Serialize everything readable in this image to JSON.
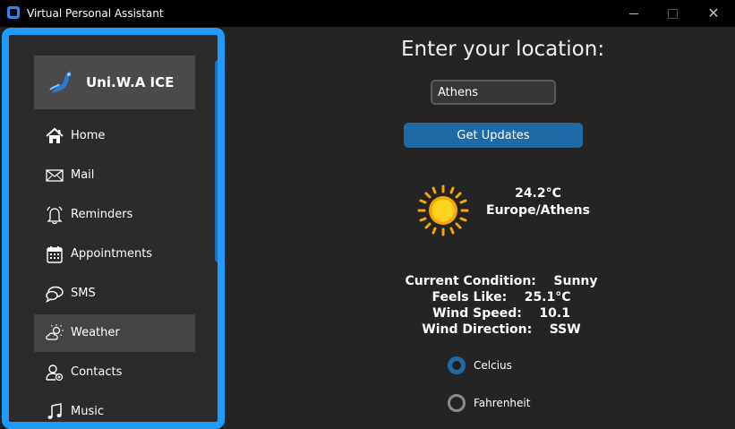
{
  "window": {
    "title": "Virtual Personal Assistant",
    "minimize": "",
    "maximize": "",
    "close": "✕"
  },
  "sidebar": {
    "logo_text": "Uni.W.A ICE",
    "items": [
      {
        "label": "Home",
        "icon": "home-icon"
      },
      {
        "label": "Mail",
        "icon": "mail-icon"
      },
      {
        "label": "Reminders",
        "icon": "bell-icon"
      },
      {
        "label": "Appointments",
        "icon": "calendar-icon"
      },
      {
        "label": "SMS",
        "icon": "chat-icon"
      },
      {
        "label": "Weather",
        "icon": "weather-icon",
        "active": true
      },
      {
        "label": "Contacts",
        "icon": "contacts-icon"
      },
      {
        "label": "Music",
        "icon": "music-icon"
      }
    ]
  },
  "main": {
    "title": "Enter your location:",
    "location_value": "Athens",
    "update_button": "Get Updates",
    "temperature": "24.2°C",
    "timezone": "Europe/Athens",
    "details": [
      {
        "label": "Current Condition:",
        "value": "Sunny"
      },
      {
        "label": "Feels Like:",
        "value": "25.1°C"
      },
      {
        "label": "Wind Speed:",
        "value": "10.1"
      },
      {
        "label": "Wind Direction:",
        "value": "SSW"
      }
    ],
    "units": [
      {
        "label": "Celcius",
        "selected": true
      },
      {
        "label": "Fahrenheit",
        "selected": false
      }
    ]
  },
  "colors": {
    "accent": "#1f9aff",
    "button": "#1f6aa5",
    "background": "#242424",
    "sidebar": "#2b2b2b",
    "active_item": "#444444"
  }
}
